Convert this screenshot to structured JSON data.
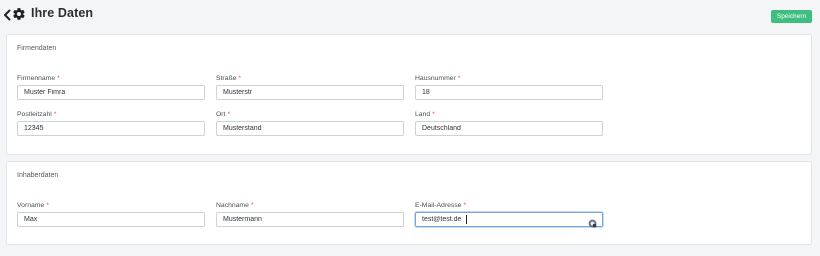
{
  "header": {
    "title": "Ihre Daten",
    "save_label": "Speichern",
    "back_icon": "chevron-left-icon",
    "settings_icon": "gear-icon"
  },
  "firmendaten": {
    "title": "Firmendaten",
    "fields": [
      {
        "label": "Firmenname",
        "required": "*",
        "value": "Muster Fimra"
      },
      {
        "label": "Straße",
        "required": "*",
        "value": "Musterstr"
      },
      {
        "label": "Hausnummer",
        "required": "*",
        "value": "18"
      },
      {
        "label": "Postleitzahl",
        "required": "*",
        "value": "12345"
      },
      {
        "label": "Ort",
        "required": "*",
        "value": "Musterstand"
      },
      {
        "label": "Land",
        "required": "*",
        "value": "Deutschland"
      }
    ]
  },
  "inhaberdaten": {
    "title": "Inhaberdaten",
    "fields": [
      {
        "label": "Vorname",
        "required": "*",
        "value": "Max"
      },
      {
        "label": "Nachname",
        "required": "*",
        "value": "Mustermann"
      },
      {
        "label": "E-Mail-Adresse",
        "required": "*",
        "value": "test@test.de"
      }
    ]
  },
  "colors": {
    "accent_green": "#3fbf7f",
    "required_red": "#e14b4b",
    "focus_blue": "#7aa4d6"
  }
}
